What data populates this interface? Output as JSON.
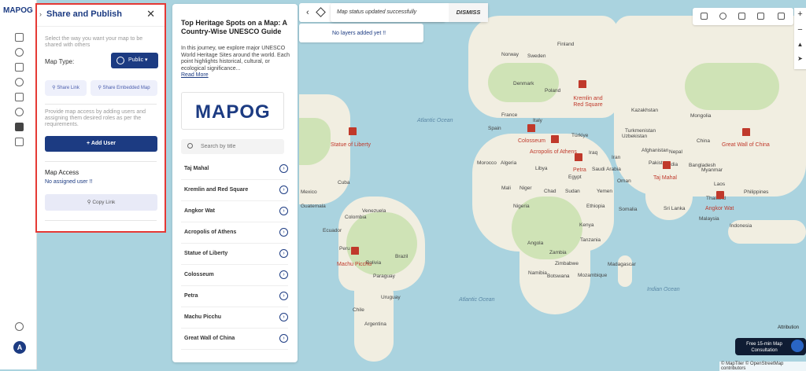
{
  "rail": {
    "logo": "MAPOG",
    "avatar_letter": "A"
  },
  "share_panel": {
    "title": "Share and Publish",
    "description": "Select the way you want your map to be shared with others",
    "map_type_label": "Map Type:",
    "map_type_value": "Public",
    "share_link": "Share Link",
    "share_embedded": "Share Embedded Map",
    "access_help": "Provide map access by adding users and assigning them desired roles as per the requirements.",
    "add_user": "+ Add User",
    "map_access_title": "Map Access",
    "no_assigned": "No assigned user !!",
    "copy_link": "Copy Link"
  },
  "story": {
    "title": "Top Heritage Spots on a Map: A Country-Wise UNESCO Guide",
    "description": "In this journey, we explore major UNESCO World Heritage Sites around the world. Each point highlights historical, cultural, or ecological significance...",
    "read_more": "Read More",
    "logo": "MAPOG",
    "search_placeholder": "Search by title",
    "items": [
      "Taj Mahal",
      "Kremlin and Red Square",
      "Angkor Wat",
      "Acropolis of Athens",
      "Statue of Liberty",
      "Colosseum",
      "Petra",
      "Machu Picchu",
      "Great Wall of China"
    ]
  },
  "toast": {
    "message": "Map status updated successfully",
    "dismiss": "DISMISS"
  },
  "layers": {
    "empty": "No layers added yet !!"
  },
  "map": {
    "oceans": [
      "Atlantic Ocean",
      "Atlantic Ocean",
      "Indian Ocean"
    ],
    "markers": [
      "Kremlin and Red Square",
      "Statue of Liberty",
      "Colosseum",
      "Acropolis of Athens",
      "Petra",
      "Taj Mahal",
      "Great Wall of China",
      "Angkor Wat",
      "Machu Picchu"
    ],
    "countries": [
      "Sweden",
      "Finland",
      "Norway",
      "Denmark",
      "Poland",
      "France",
      "Spain",
      "Italy",
      "Türkiye",
      "Kazakhstan",
      "Mongolia",
      "China",
      "Iran",
      "Iraq",
      "Egypt",
      "Libya",
      "Algeria",
      "Mali",
      "Niger",
      "Chad",
      "Sudan",
      "Nigeria",
      "Saudi Arabia",
      "Yemen",
      "Oman",
      "India",
      "Myanmar",
      "Philippines",
      "Indonesia",
      "Sri Lanka",
      "Kenya",
      "Angola",
      "Zambia",
      "Madagascar",
      "Namibia",
      "Botswana",
      "Brazil",
      "Peru",
      "Bolivia",
      "Paraguay",
      "Chile",
      "Argentina",
      "Uruguay",
      "Colombia",
      "Venezuela",
      "Cuba",
      "Mexico",
      "Guatemala",
      "Ecuador",
      "Morocco",
      "Ethiopia",
      "Somalia",
      "Tanzania",
      "Zimbabwe",
      "Mozambique",
      "Afghanistan",
      "Pakistan",
      "Turkmenistan",
      "Uzbekistan",
      "Thailand",
      "Laos",
      "Malaysia",
      "Nepal",
      "Bangladesh"
    ]
  },
  "controls": {
    "attribution": "Attribution",
    "chat": "Free 15-min Map Consultation",
    "copyright": "© MapTiler © OpenStreetMap contributors"
  }
}
